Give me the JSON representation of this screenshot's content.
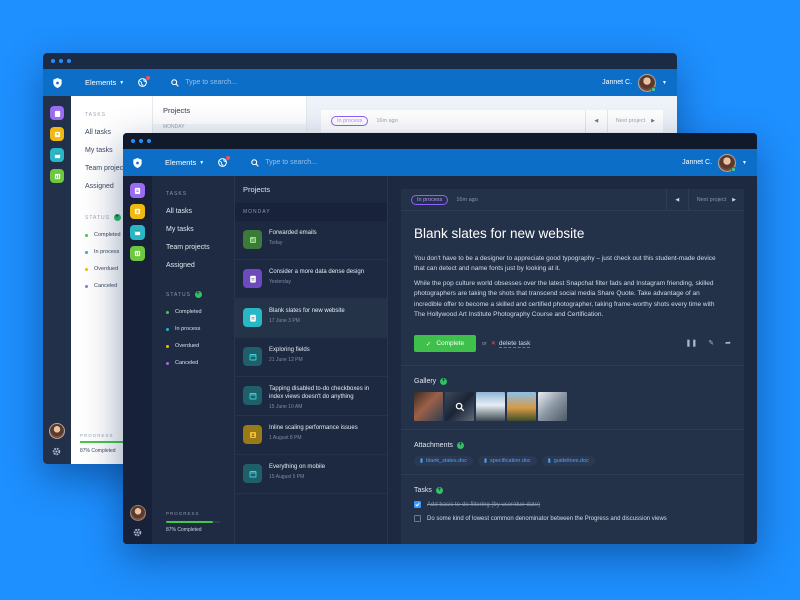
{
  "colors": {
    "background": "#1e90ff",
    "topbar": "#0d6ec7",
    "accent_green": "#3fbf4b",
    "accent_purple": "#8e62ff",
    "link_blue": "#4aa4ff"
  },
  "topbar": {
    "menu_label": "Elements",
    "search_placeholder": "Type to search...",
    "user_name": "Jannet C."
  },
  "sidebar_apps": [
    {
      "name": "purple-app",
      "color": "#9b6bf2"
    },
    {
      "name": "yellow-app",
      "color": "#f0b812"
    },
    {
      "name": "teal-app",
      "color": "#27b7c6"
    },
    {
      "name": "green-app",
      "color": "#6dc83f"
    }
  ],
  "nav": {
    "tasks_heading": "TASKS",
    "items": [
      "All tasks",
      "My tasks",
      "Team projects",
      "Assigned"
    ],
    "status_heading": "STATUS",
    "statuses": [
      {
        "label": "Completed",
        "color": "#45c84a"
      },
      {
        "label": "In process",
        "color": "#1fb5d4"
      },
      {
        "label": "Overdued",
        "color": "#f0b812"
      },
      {
        "label": "Canceled",
        "color": "#9b6bf2"
      }
    ],
    "progress_label": "PROGRESS",
    "progress_value": 0.87,
    "progress_text": "87% Completed"
  },
  "projects": {
    "title": "Projects",
    "day_label": "MONDAY",
    "items": [
      {
        "name": "Forwarded emails",
        "date": "Today",
        "color": "#3c7a3a",
        "icon": "chart-icon"
      },
      {
        "name": "Consider a more data dense design",
        "date": "Yesterday",
        "color": "#6b4bbd",
        "icon": "clipboard-icon"
      },
      {
        "name": "Blank slates for new website",
        "date": "17 June 3 PM",
        "color": "#27b7c6",
        "icon": "clipboard-icon"
      },
      {
        "name": "Exploring fields",
        "date": "21 June 12 PM",
        "color": "#1f5f6a",
        "icon": "calendar-icon"
      },
      {
        "name": "Tapping disabled to-do checkboxes in index views doesn't do anything",
        "date": "15 June 10 AM",
        "color": "#1f5f6a",
        "icon": "calendar-icon"
      },
      {
        "name": "Inline scaling performance issues",
        "date": "1 August 8 PM",
        "color": "#9a7a17",
        "icon": "person-icon"
      },
      {
        "name": "Everything on mobile",
        "date": "15 August 5 PM",
        "color": "#1f5f6a",
        "icon": "calendar-icon"
      }
    ]
  },
  "detail": {
    "status_badge": "In process",
    "time_ago": "16m ago",
    "next_label": "Next project",
    "title": "Blank slates for new website",
    "paragraph1": "You don't have to be a designer to appreciate good typography – just check out this student-made device that can detect and name fonts just by looking at it.",
    "paragraph2": "While the pop culture world obsesses over the latest Snapchat filter fads and Instagram friending, skilled photographers are taking the shots that transcend social media Share Quote. Take advantage of an incredible offer to become a skilled and certified photographer, taking frame-worthy shots every time with The Hollywood Art Institute Photography Course and Certification.",
    "complete_label": "Complete",
    "or_text": "or",
    "delete_label": "delete task",
    "gallery_title": "Gallery",
    "attachments_title": "Attachments",
    "attachments": [
      "blank_slates.doc",
      "specification.doc",
      "guidelines.doc"
    ],
    "tasks_title": "Tasks",
    "tasks": [
      {
        "text": "Add basic to-do filtering (by user/due date)",
        "done": true
      },
      {
        "text": "Do some kind of lowest common denominator between the Progress and discussion views",
        "done": false
      }
    ]
  },
  "back_window": {
    "status_badge": "In process",
    "time_ago": "16m ago",
    "next_label": "Next project",
    "projects_title": "Projects",
    "day_label": "MONDAY",
    "tasks_heading": "TASKS",
    "nav_items": [
      "All tasks",
      "My tasks",
      "Team projects",
      "Assigned"
    ],
    "status_heading": "STATUS",
    "statuses": [
      "Completed",
      "In process",
      "Overdued",
      "Canceled"
    ],
    "progress_label": "PROGRESS",
    "progress_value": 0.87,
    "progress_text": "87% Completed"
  }
}
